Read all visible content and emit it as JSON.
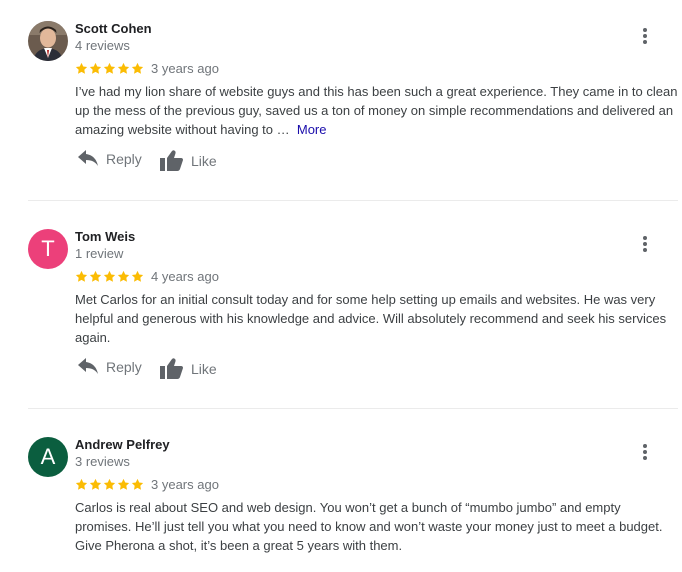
{
  "reviews": [
    {
      "name": "Scott Cohen",
      "review_count": "4 reviews",
      "rating": 5,
      "date": "3 years ago",
      "text": "I’ve had my lion share of website guys and this has been such a great experience.  They came in to clean up the mess of the previous guy, saved us a ton of money on simple recommendations and delivered an amazing website without having to …",
      "more_label": "More",
      "reply_label": "Reply",
      "like_label": "Like",
      "avatar_type": "photo"
    },
    {
      "name": "Tom Weis",
      "review_count": "1 review",
      "rating": 5,
      "date": "4 years ago",
      "text": "Met Carlos for an initial consult today and for some help setting up emails and websites.  He was very helpful and generous with his knowledge and advice.  Will absolutely recommend and seek his services again.",
      "reply_label": "Reply",
      "like_label": "Like",
      "avatar_letter": "T",
      "avatar_color": "#ec407a"
    },
    {
      "name": "Andrew Pelfrey",
      "review_count": "3 reviews",
      "rating": 5,
      "date": "3 years ago",
      "text": "Carlos is real about SEO and web design. You won’t get a bunch of “mumbo jumbo” and empty promises. He’ll just tell you what you need to know and won’t waste your money just to meet a budget. Give Pherona a shot, it’s been a great 5 years with them.",
      "avatar_letter": "A",
      "avatar_color": "#0b5e3f"
    }
  ],
  "colors": {
    "star": "#fbbc04",
    "meta_text": "#70757a",
    "link": "#1a0dab",
    "divider": "#ebebeb"
  },
  "icons": {
    "reply": "reply-arrow-icon",
    "like": "thumbs-up-icon",
    "menu": "more-vertical-icon",
    "star": "star-icon"
  }
}
